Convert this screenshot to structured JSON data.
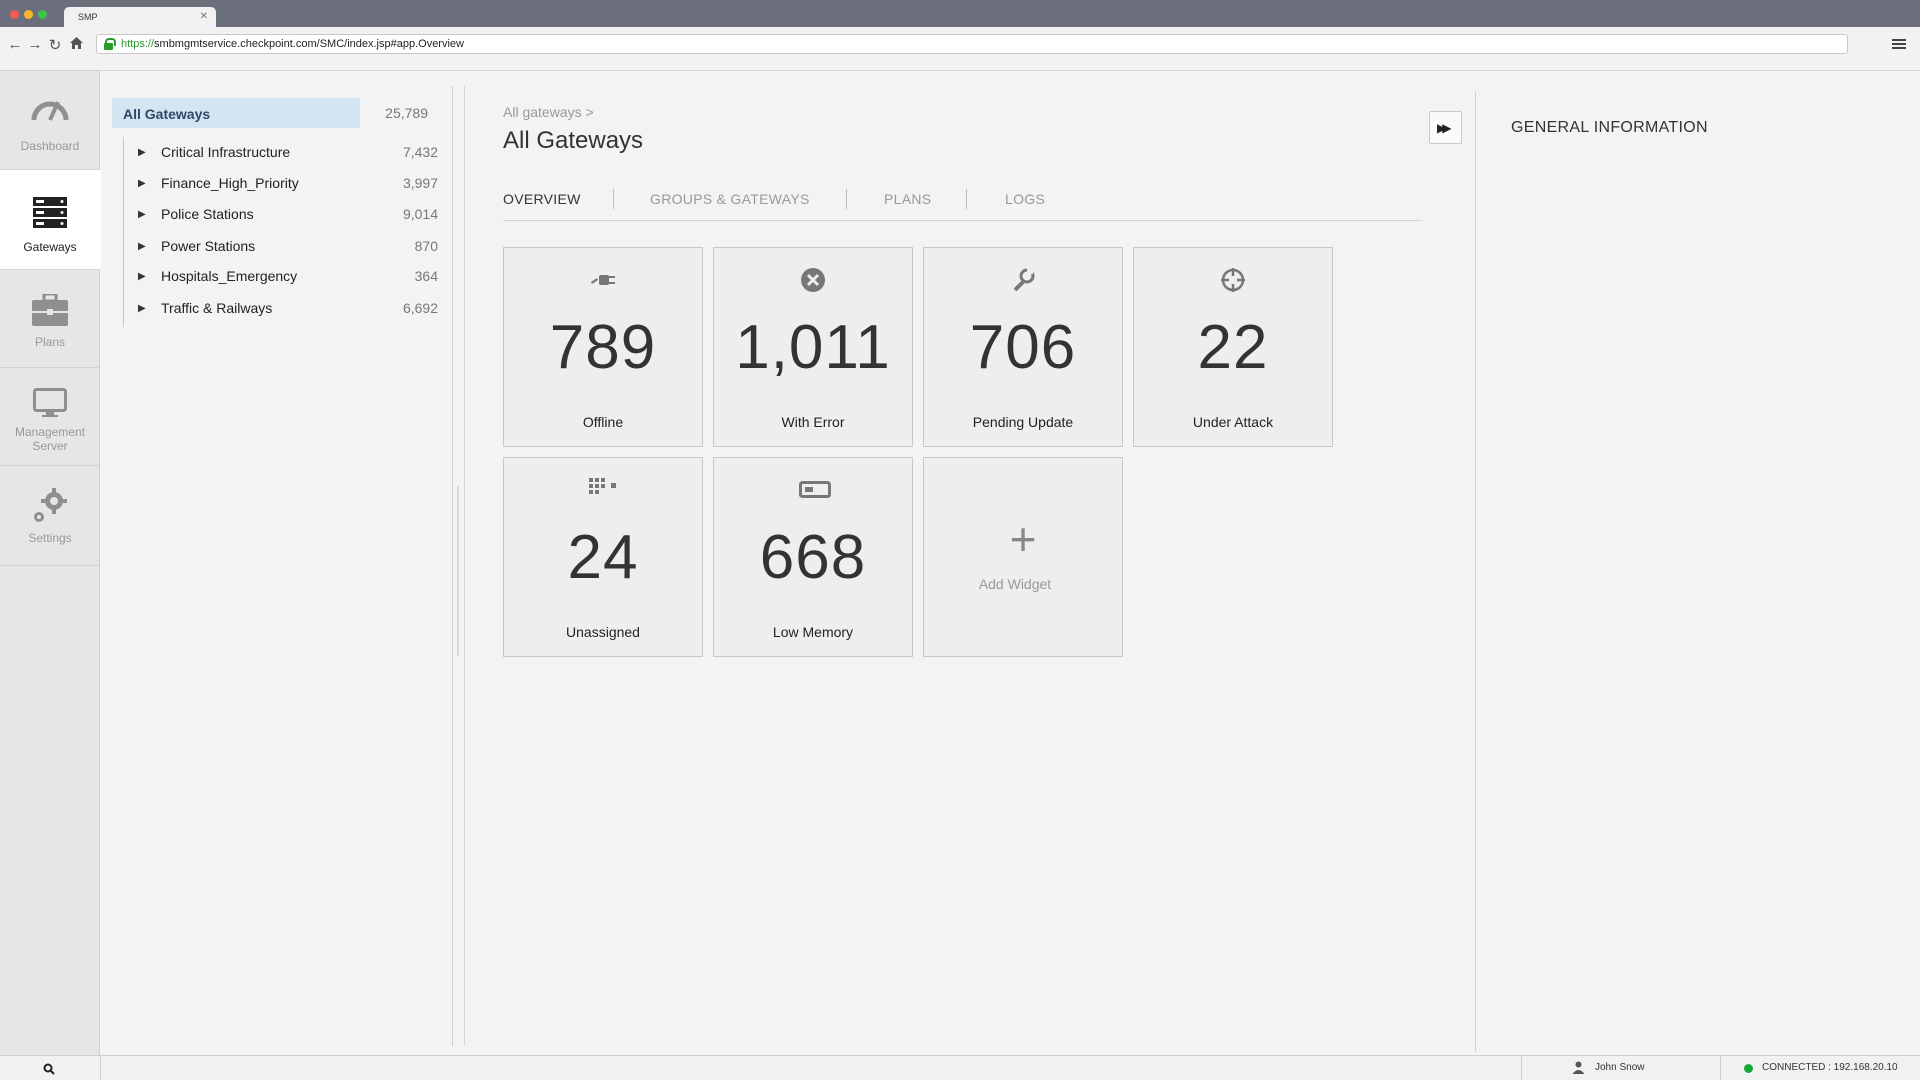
{
  "browser": {
    "tab_title": "SMP",
    "url_scheme": "https://",
    "url_rest": "smbmgmtservice.checkpoint.com/SMC/index.jsp#app.Overview"
  },
  "nav": {
    "items": [
      {
        "label": "Dashboard",
        "icon": "gauge-icon"
      },
      {
        "label": "Gateways",
        "icon": "server-stack-icon",
        "active": true
      },
      {
        "label": "Plans",
        "icon": "briefcase-icon"
      },
      {
        "label": "Management",
        "label2": "Server",
        "icon": "monitor-icon"
      },
      {
        "label": "Settings",
        "icon": "gears-icon"
      }
    ]
  },
  "tree": {
    "root": {
      "name": "All Gateways",
      "count": "25,789"
    },
    "items": [
      {
        "name": "Critical Infrastructure",
        "count": "7,432"
      },
      {
        "name": "Finance_High_Priority",
        "count": "3,997"
      },
      {
        "name": "Police Stations",
        "count": "9,014"
      },
      {
        "name": "Power Stations",
        "count": "870"
      },
      {
        "name": "Hospitals_Emergency",
        "count": "364"
      },
      {
        "name": "Traffic & Railways",
        "count": "6,692"
      }
    ]
  },
  "main": {
    "breadcrumb": "All gateways >",
    "title": "All Gateways",
    "tabs": [
      "OVERVIEW",
      "GROUPS & GATEWAYS",
      "PLANS",
      "LOGS"
    ],
    "tiles": [
      {
        "value": "789",
        "label": "Offline",
        "icon": "unplugged-icon"
      },
      {
        "value": "1,011",
        "label": "With Error",
        "icon": "error-circle-icon"
      },
      {
        "value": "706",
        "label": "Pending Update",
        "icon": "wrench-icon"
      },
      {
        "value": "22",
        "label": "Under Attack",
        "icon": "crosshair-icon"
      },
      {
        "value": "24",
        "label": "Unassigned",
        "icon": "grid-dots-icon"
      },
      {
        "value": "668",
        "label": "Low Memory",
        "icon": "memory-icon"
      }
    ],
    "add_widget": "Add Widget"
  },
  "right_panel": {
    "title": "GENERAL INFORMATION"
  },
  "status": {
    "user": "John Snow",
    "connection": "CONNECTED : 192.168.20.10"
  }
}
